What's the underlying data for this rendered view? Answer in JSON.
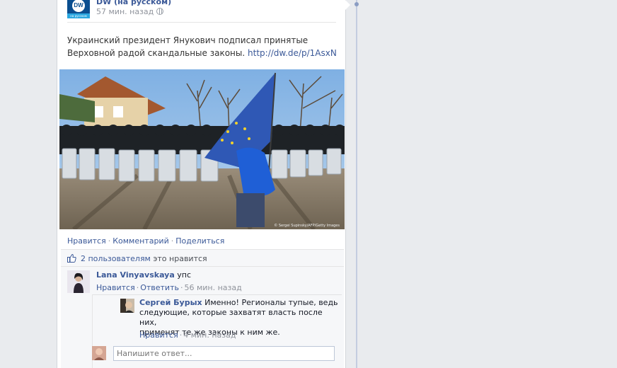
{
  "post": {
    "page_name": "DW (на русском)",
    "timestamp": "57 мин. назад",
    "text": "Украинский президент Янукович подписал принятые Верховной радой скандальные законы.",
    "link": "http://dw.de/p/1AsxN",
    "photo_credit": "© Sergei Supinsky/AFP/Getty Images",
    "logo_text": "DW",
    "logo_sub": "на русском"
  },
  "actions": {
    "like": "Нравится",
    "comment": "Комментарий",
    "share": "Поделиться",
    "separator": "·"
  },
  "likes": {
    "count_text": "2 пользователям",
    "rest_text": "это нравится"
  },
  "comments": [
    {
      "author": "Lana Vinyavskaya",
      "text": "упс",
      "like": "Нравится",
      "reply": "Ответить",
      "time": "56 мин. назад"
    }
  ],
  "replies": [
    {
      "author": "Сергей Бурых",
      "text_line1": "Именно! Регионалы тупые, ведь",
      "text_line2": "следующие, которые захватят власть после них,",
      "text_line3": "применят те же законы к ним же.",
      "like": "Нравится",
      "time": "4 мин. назад"
    }
  ],
  "reply_input": {
    "placeholder": "Напишите ответ..."
  },
  "colors": {
    "link": "#3b5998",
    "background": "#e9ebee",
    "dw_blue": "#0a4e8f"
  }
}
